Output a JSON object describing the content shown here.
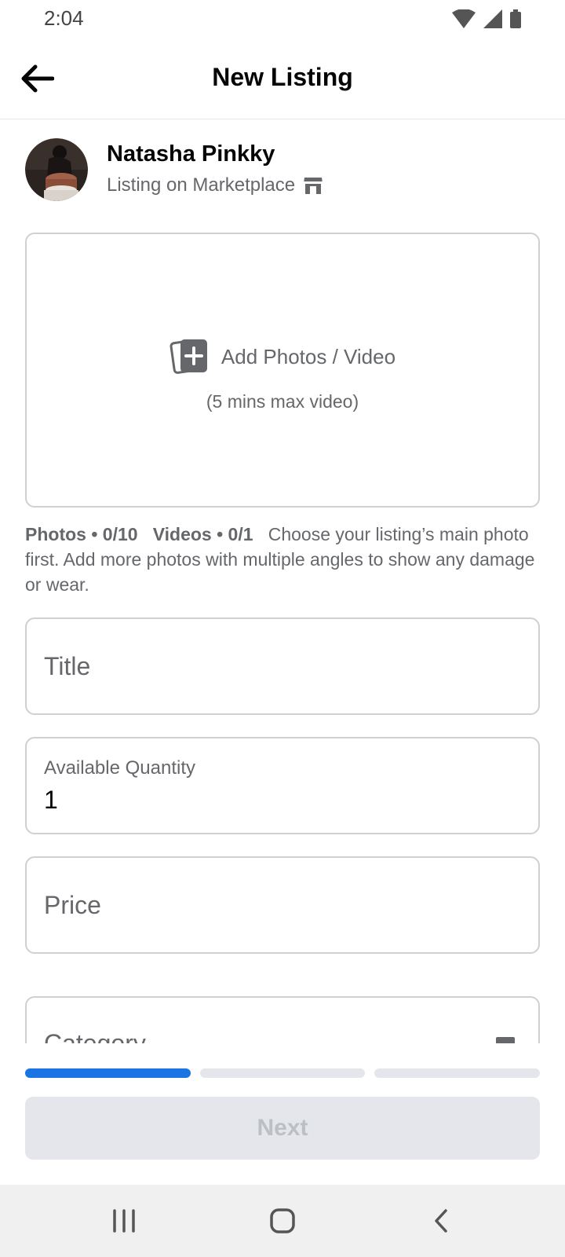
{
  "status": {
    "time": "2:04"
  },
  "header": {
    "title": "New Listing"
  },
  "profile": {
    "name": "Natasha Pinkky",
    "subtitle": "Listing on Marketplace"
  },
  "media": {
    "add_label": "Add Photos / Video",
    "sub_label": "(5 mins max video)"
  },
  "helper": {
    "photos": "Photos • 0/10",
    "videos": "Videos • 0/1",
    "text": "Choose your listing’s main photo first. Add more photos with multiple angles to show any damage or wear."
  },
  "fields": {
    "title": {
      "placeholder": "Title"
    },
    "quantity": {
      "label": "Available Quantity",
      "value": "1"
    },
    "price": {
      "placeholder": "Price"
    },
    "category": {
      "placeholder": "Category"
    }
  },
  "progress": {
    "current_step": 1,
    "total_steps": 3
  },
  "footer": {
    "next_label": "Next"
  },
  "colors": {
    "accent": "#1b74e4",
    "border": "#ced0d4",
    "muted": "#65676b"
  }
}
